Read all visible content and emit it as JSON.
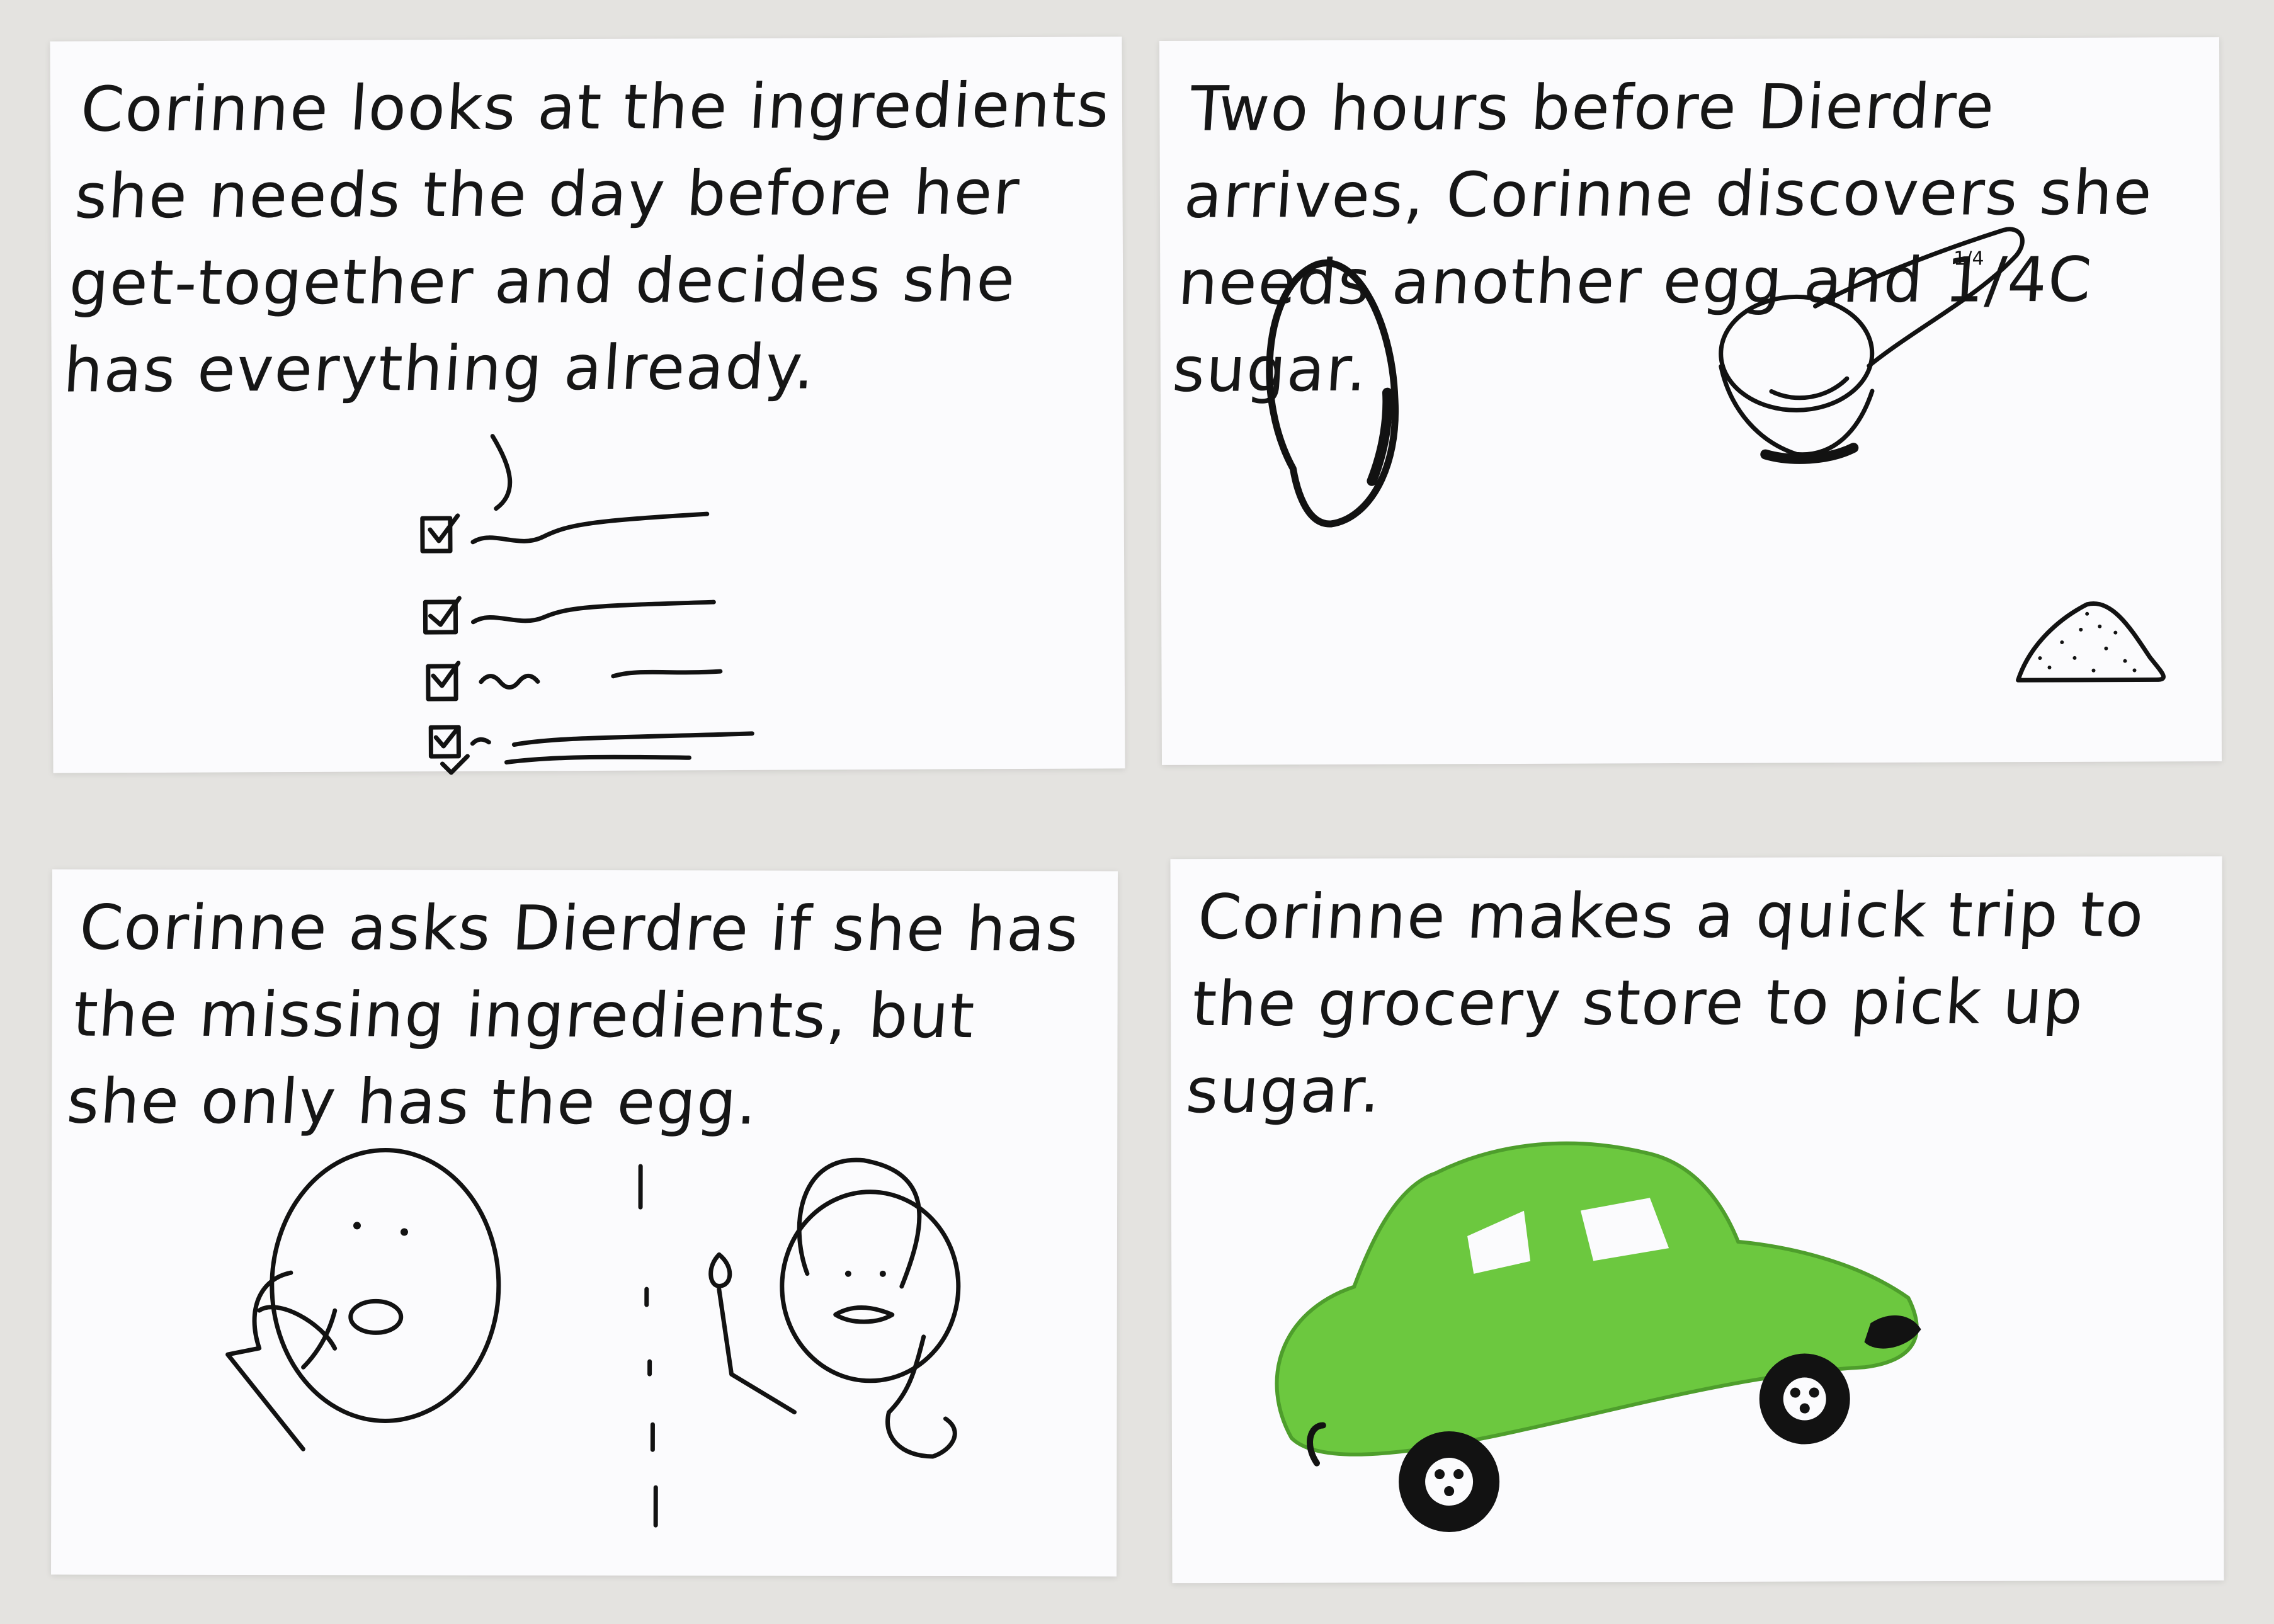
{
  "storyboard": {
    "panels": [
      {
        "caption": "Corinne looks at the ingredients she needs the day before her get-together and decides she has everything already."
      },
      {
        "caption": "Two hours before Dierdre arrives, Corinne discovers she needs another egg and 1/4C sugar.",
        "measuring_cup_label": "1/4"
      },
      {
        "caption": "Corinne asks Dierdre if she has the missing ingredients, but she only has the egg."
      },
      {
        "caption": "Corinne makes a quick trip to the grocery store to pick up sugar."
      }
    ]
  },
  "colors": {
    "background": "#e4e3e0",
    "card": "#fbfbfd",
    "ink": "#121212",
    "car_green": "#6cc83f"
  }
}
